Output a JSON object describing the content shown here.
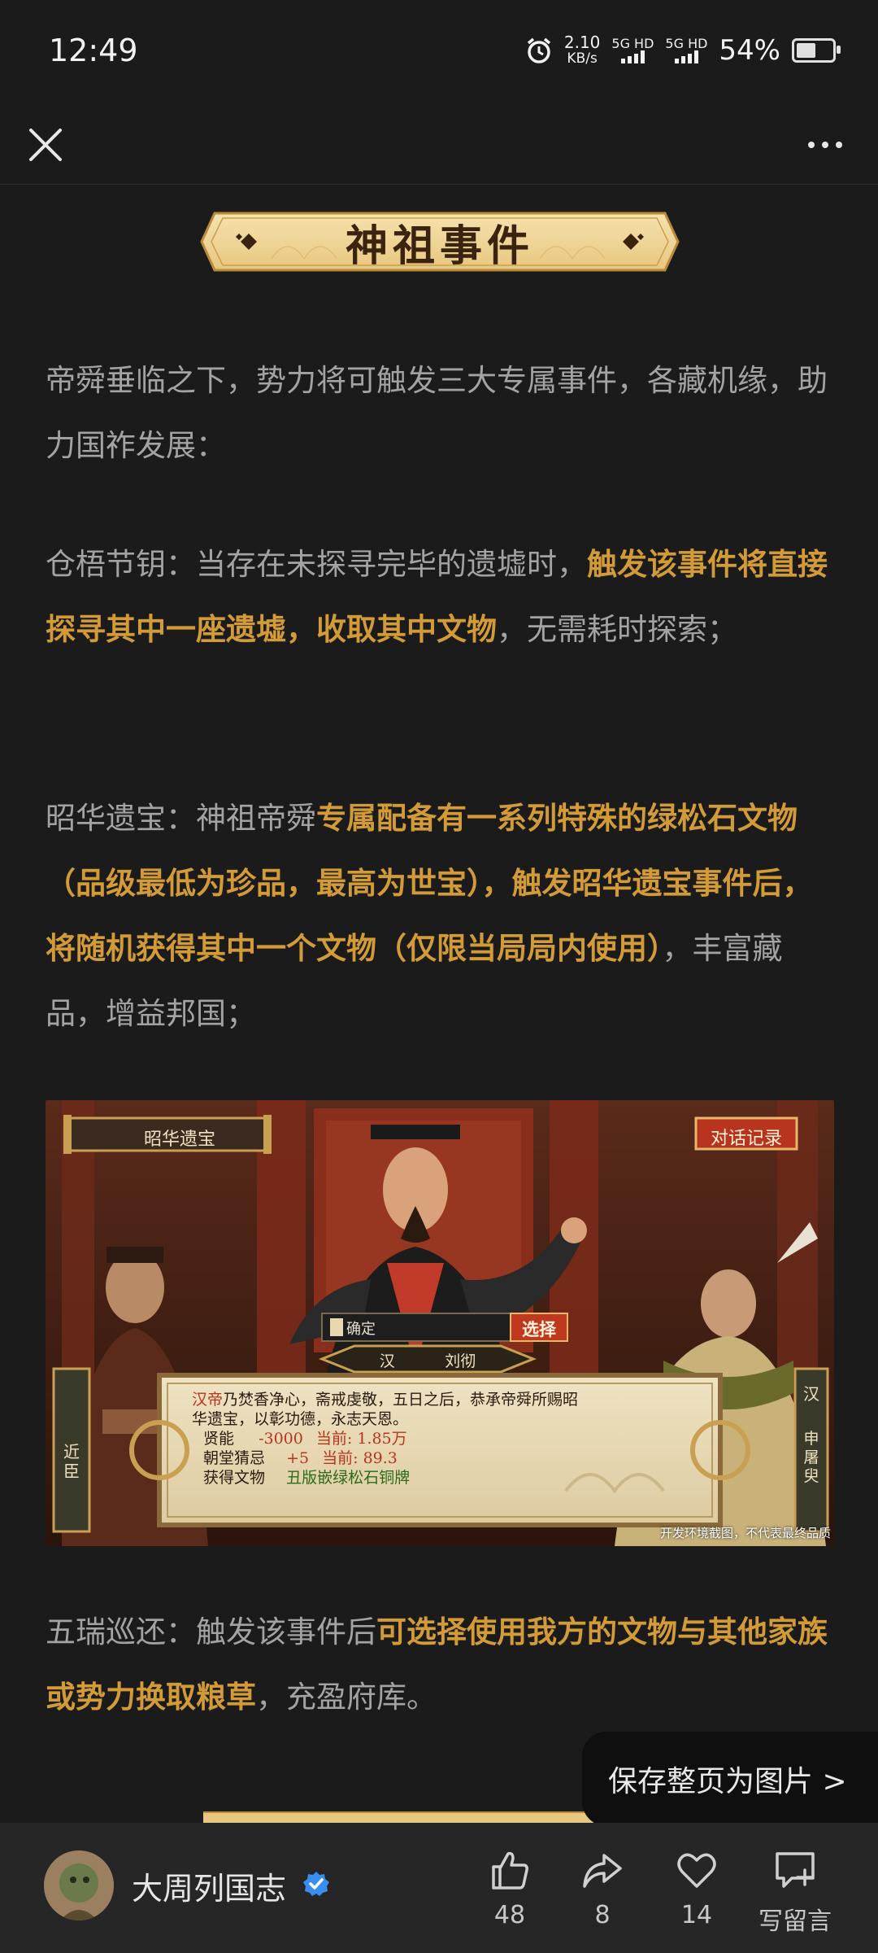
{
  "status_bar": {
    "time": "12:49",
    "net_speed_value": "2.10",
    "net_speed_unit": "KB/s",
    "sim1": "5G HD",
    "sim2": "5G HD",
    "battery_pct": "54%",
    "battery_level": 0.54
  },
  "article": {
    "section_title": "神祖事件",
    "intro": "帝舜垂临之下，势力将可触发三大专属事件，各藏机缘，助力国祚发展：",
    "event1": {
      "name": "仓梧节钥：",
      "text_a": "当存在未探寻完毕的遗墟时，",
      "highlight": "触发该事件将直接探寻其中一座遗墟，收取其中文物",
      "text_b": "，无需耗时探索；"
    },
    "event2": {
      "name": "昭华遗宝：",
      "text_a": "神祖帝舜",
      "highlight": "专属配备有一系列特殊的绿松石文物（品级最低为珍品，最高为世宝），触发昭华遗宝事件后，将随机获得其中一个文物（仅限当局局内使用）",
      "text_b": "，丰富藏品，增益邦国；"
    },
    "figure": {
      "event_title": "昭华遗宝",
      "dialog_log_button": "对话记录",
      "input_value": "确定",
      "choose_button": "选择",
      "nameplate_faction": "汉",
      "nameplate_name": "刘彻",
      "left_side_tag": "近臣",
      "right_side_tag_1": "汉",
      "right_side_tag_2": "申屠臾",
      "dialog_speaker": "汉帝",
      "dialog_line1": "乃焚香净心，斋戒虔敬，五日之后，恭承帝舜所赐昭",
      "dialog_line2": "华遗宝，以彰功德，永志天恩。",
      "stat1_label": "贤能",
      "stat1_delta": "-3000",
      "stat1_current_label": "当前:",
      "stat1_current": "1.85万",
      "stat2_label": "朝堂猜忌",
      "stat2_delta": "+5",
      "stat2_current_label": "当前:",
      "stat2_current": "89.3",
      "stat3_label": "获得文物",
      "stat3_value": "丑版嵌绿松石铜牌",
      "caption": "开发环境截图，不代表最终品质"
    },
    "event3": {
      "name": "五瑞巡还：",
      "text_a": "触发该事件后",
      "highlight": "可选择使用我方的文物与其他家族或势力换取粮草",
      "text_b": "，充盈府库。"
    }
  },
  "save_pill_label": "保存整页为图片 >",
  "bottom_bar": {
    "author": "大周列国志",
    "likes": "48",
    "shares": "8",
    "favorites": "14",
    "comment_label": "写留言"
  },
  "colors": {
    "background": "#1b1b1b",
    "body_text": "#a3a3a3",
    "highlight": "#d29b37",
    "banner_gold": "#f0d89c",
    "bottom_bar": "#262626"
  }
}
